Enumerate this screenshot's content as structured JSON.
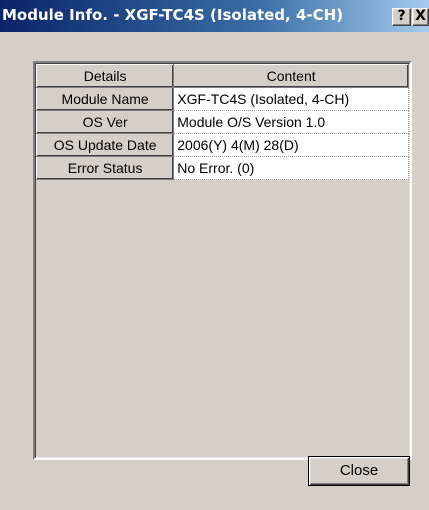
{
  "window": {
    "title": "Module Info. - XGF-TC4S (Isolated, 4-CH)",
    "help_button_label": "?",
    "close_x_label": "X"
  },
  "table": {
    "headers": [
      "Details",
      "Content"
    ],
    "rows": [
      {
        "label": "Module Name",
        "value": "XGF-TC4S (Isolated, 4-CH)"
      },
      {
        "label": "OS Ver",
        "value": "Module O/S Version  1.0"
      },
      {
        "label": "OS Update Date",
        "value": "2006(Y)  4(M) 28(D)"
      },
      {
        "label": "Error Status",
        "value": "No Error. (0)"
      }
    ]
  },
  "footer": {
    "close_label": "Close"
  },
  "colors": {
    "title_bar": "#0a246a",
    "dialog_face": "#d4d0c8"
  }
}
